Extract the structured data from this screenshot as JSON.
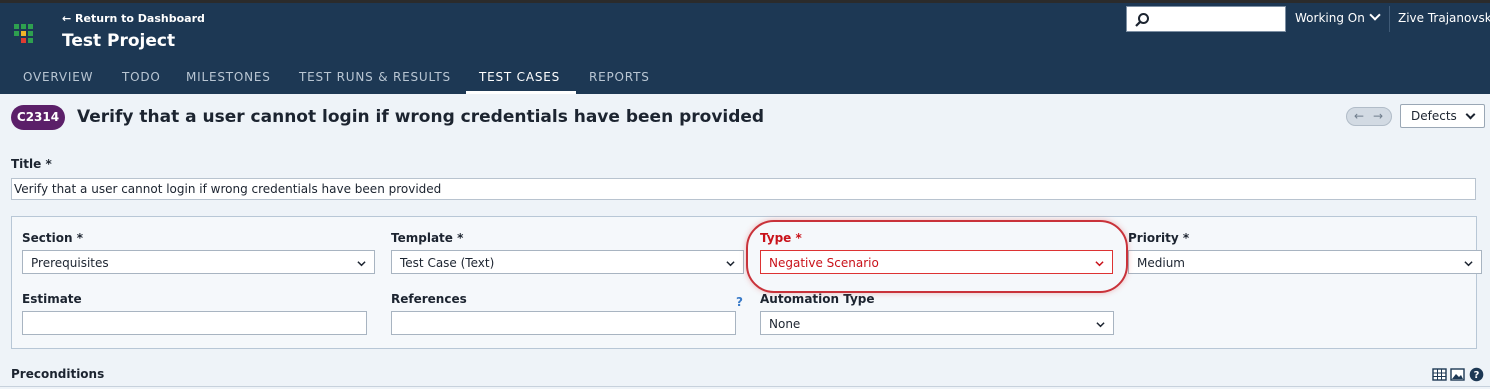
{
  "header": {
    "back_link": "← Return to Dashboard",
    "project_title": "Test Project",
    "search_placeholder": "",
    "working_on": "Working On",
    "user_name": "Zive Trajanovsk",
    "tabs": [
      {
        "label": "OVERVIEW"
      },
      {
        "label": "TODO"
      },
      {
        "label": "MILESTONES"
      },
      {
        "label": "TEST RUNS & RESULTS"
      },
      {
        "label": "TEST CASES",
        "active": true
      },
      {
        "label": "REPORTS"
      }
    ],
    "colors": {
      "background": "#1d3854",
      "accent": "#ffffff"
    }
  },
  "case": {
    "id": "C2314",
    "title": "Verify that a user cannot login if wrong credentials have been provided",
    "defects_label": "Defects",
    "nav_prev": "←",
    "nav_next": "→"
  },
  "form": {
    "title_label": "Title *",
    "title_value": "Verify that a user cannot login if wrong credentials have been provided",
    "section_label": "Section *",
    "section_value": "Prerequisites",
    "template_label": "Template *",
    "template_value": "Test Case (Text)",
    "type_label": "Type *",
    "type_value": "Negative Scenario",
    "priority_label": "Priority *",
    "priority_value": "Medium",
    "estimate_label": "Estimate",
    "estimate_value": "",
    "references_label": "References",
    "references_help": "?",
    "references_value": "",
    "automation_label": "Automation Type",
    "automation_value": "None",
    "preconditions_label": "Preconditions"
  },
  "icons": [
    "return-arrow-icon",
    "search-icon",
    "chevron-down-icon",
    "table-icon",
    "image-icon",
    "help-icon"
  ]
}
